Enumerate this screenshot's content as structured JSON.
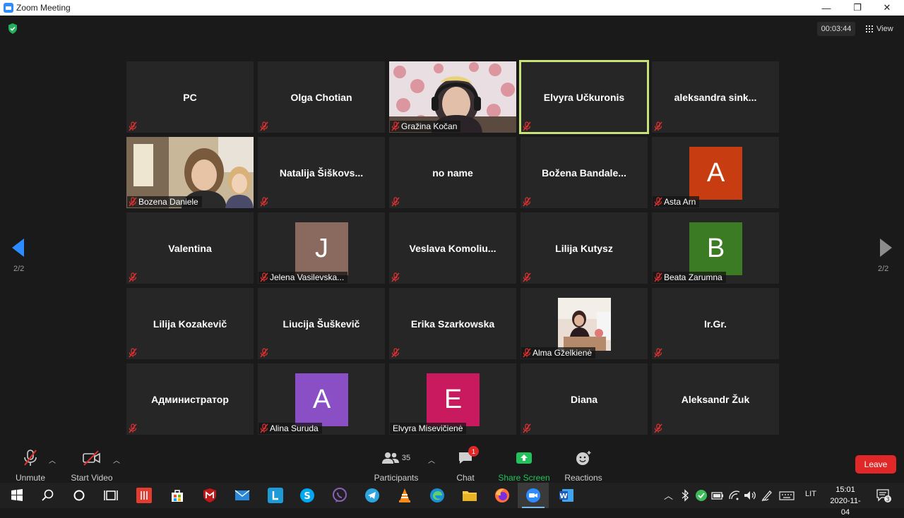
{
  "window": {
    "title": "Zoom Meeting",
    "minimize": "—",
    "maximize": "❐",
    "close": "✕"
  },
  "topbar": {
    "timer": "00:03:44",
    "view_label": "View"
  },
  "pagination": {
    "left_page": "2/2",
    "right_page": "2/2"
  },
  "participants_grid": [
    {
      "name": "PC",
      "type": "name"
    },
    {
      "name": "Olga Chotian",
      "type": "name"
    },
    {
      "name": "Gražina Kočan",
      "type": "video"
    },
    {
      "name": "Elvyra Učkuronis",
      "type": "name",
      "speaking": true
    },
    {
      "name": "aleksandra  sink...",
      "type": "name"
    },
    {
      "name": "Bozena Daniele",
      "type": "video"
    },
    {
      "name": "Natalija  Šiškovs...",
      "type": "name"
    },
    {
      "name": "no name",
      "type": "name"
    },
    {
      "name": "Božena  Bandale...",
      "type": "name"
    },
    {
      "name": "Asta Arn",
      "type": "avatar",
      "initial": "A",
      "color": "#c83c12"
    },
    {
      "name": "Valentina",
      "type": "name"
    },
    {
      "name": "Jelena Vasilevska...",
      "type": "avatar",
      "initial": "J",
      "color": "#8a6a5f"
    },
    {
      "name": "Veslava  Komoliu...",
      "type": "name"
    },
    {
      "name": "Lilija Kutysz",
      "type": "name"
    },
    {
      "name": "Beata Zarumna",
      "type": "avatar",
      "initial": "B",
      "color": "#3b7b23"
    },
    {
      "name": "Lilija Kozakevič",
      "type": "name"
    },
    {
      "name": "Liucija Šuškevič",
      "type": "name"
    },
    {
      "name": "Erika Szarkowska",
      "type": "name"
    },
    {
      "name": "Alma Gželkienė",
      "type": "photo"
    },
    {
      "name": "Ir.Gr.",
      "type": "name"
    },
    {
      "name": "Администратор",
      "type": "name"
    },
    {
      "name": "Alina Suruda",
      "type": "avatar",
      "initial": "A",
      "color": "#8a4fc4"
    },
    {
      "name": "Elvyra Misevičienė",
      "type": "avatar",
      "initial": "E",
      "color": "#c91a5f",
      "no_mute": true
    },
    {
      "name": "Diana",
      "type": "name"
    },
    {
      "name": "Aleksandr Žuk",
      "type": "name"
    }
  ],
  "toolbar": {
    "unmute": "Unmute",
    "start_video": "Start Video",
    "participants": "Participants",
    "participants_count": "35",
    "chat": "Chat",
    "chat_badge": "1",
    "share_screen": "Share Screen",
    "reactions": "Reactions",
    "leave": "Leave",
    "share_color": "#21c35a",
    "leave_color": "#e02828"
  },
  "taskbar": {
    "language": "LIT",
    "time": "15:01",
    "date": "2020-11-04",
    "notification_count": "3"
  }
}
